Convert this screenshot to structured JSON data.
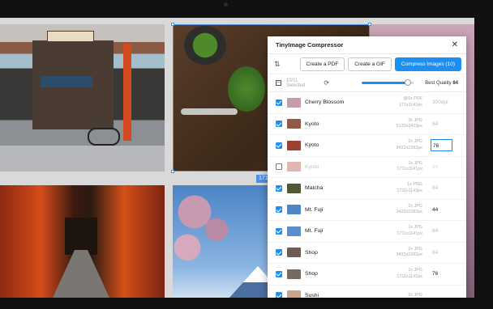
{
  "window": {
    "selection_size_label": "171"
  },
  "plugin": {
    "title": "TinyImage Compressor",
    "buttons": {
      "pdf": "Create a PDF",
      "gif": "Create a GIF",
      "compress": "Compress Images (10)"
    },
    "selected_count": "10/11 Selected",
    "quality_label": "Best Quality",
    "quality_value": "84",
    "quality_fraction": 0.84,
    "rows": [
      {
        "name": "Cherry Blossom",
        "mult": "@1x PDF",
        "dims": "171x1141px",
        "value": "300dpi",
        "checked": true,
        "thumb": "#c79ab0",
        "value_style": "muted"
      },
      {
        "name": "Kyoto",
        "mult": "3x JPG",
        "dims": "5133x3423px",
        "value": "84",
        "checked": true,
        "thumb": "#8f5b47",
        "value_style": "muted"
      },
      {
        "name": "Kyoto",
        "mult": "2x JPG",
        "dims": "3422x2282px",
        "value": "76",
        "checked": true,
        "thumb": "#9c4232",
        "value_style": "editing"
      },
      {
        "name": "Kyoto",
        "mult": "1x JPG",
        "dims": "1711x1141px",
        "value": "84",
        "checked": false,
        "thumb": "#b4473a",
        "value_style": "muted"
      },
      {
        "name": "Matcha",
        "mult": "1x PNG",
        "dims": "1711x1143px",
        "value": "84",
        "checked": true,
        "thumb": "#4c5a35",
        "value_style": "muted"
      },
      {
        "name": "Mt. Fuji",
        "mult": "2x JPG",
        "dims": "3422x2282px",
        "value": "44",
        "checked": true,
        "thumb": "#4f86c6",
        "value_style": "dark"
      },
      {
        "name": "Mt. Fuji",
        "mult": "1x JPG",
        "dims": "1711x1141px",
        "value": "84",
        "checked": true,
        "thumb": "#5a8fcc",
        "value_style": "muted"
      },
      {
        "name": "Shop",
        "mult": "2x JPG",
        "dims": "3422x2282px",
        "value": "84",
        "checked": true,
        "thumb": "#6e5d52",
        "value_style": "muted"
      },
      {
        "name": "Shop",
        "mult": "1x JPG",
        "dims": "1711x1141px",
        "value": "76",
        "checked": true,
        "thumb": "#7a6a5e",
        "value_style": "dark"
      },
      {
        "name": "Sushi",
        "mult": "2x JPG",
        "dims": "",
        "value": "",
        "checked": true,
        "thumb": "#c8a58a",
        "value_style": "muted"
      }
    ]
  },
  "icons": {
    "close": "close-icon",
    "adjust": "sliders-icon",
    "refresh": "refresh-icon",
    "deselect": "minus-icon"
  }
}
